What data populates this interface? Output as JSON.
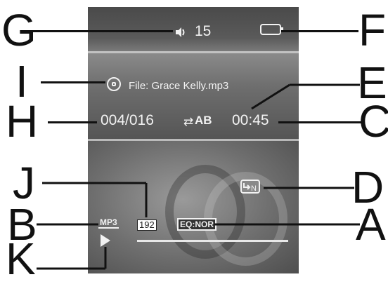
{
  "screen": {
    "volume": {
      "icon": "speaker-icon",
      "value": "15"
    },
    "battery": {
      "icon": "battery-icon"
    },
    "file": {
      "icon": "disc-icon",
      "label": "File: Grace Kelly.mp3"
    },
    "track_counter": "004/016",
    "repeat": {
      "icon": "repeat-icon",
      "mode": "AB"
    },
    "elapsed_time": "00:45",
    "subfolder": {
      "icon": "subfolder-icon",
      "label": "N"
    },
    "format_badge": "MP3",
    "bitrate_badge": "192",
    "eq_badge": "EQ:NOR",
    "play_state": {
      "icon": "play-icon"
    },
    "progress": 0.0
  },
  "callouts": {
    "G": "G",
    "F": "F",
    "I": "I",
    "E": "E",
    "H": "H",
    "C": "C",
    "J": "J",
    "D": "D",
    "B": "B",
    "A": "A",
    "K": "K"
  }
}
